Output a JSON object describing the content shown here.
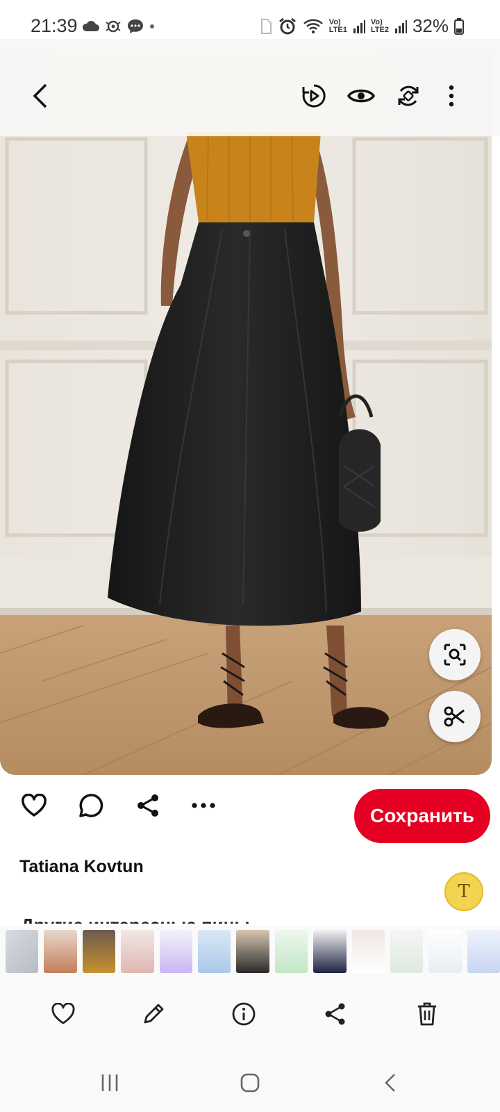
{
  "status_bar": {
    "time": "21:39",
    "battery": "32%",
    "sim1_label_top": "Vo)",
    "sim1_label_bottom": "LTE1",
    "sim2_label_top": "Vo)",
    "sim2_label_bottom": "LTE2",
    "left_icons": [
      "cloud-icon",
      "gear-bug-icon",
      "message-bubble-icon",
      "dot-icon"
    ],
    "right_icons": [
      "sim-icon",
      "alarm-icon",
      "wifi-icon",
      "signal-icon",
      "battery-icon"
    ]
  },
  "top_bar": {
    "icons": [
      "back-chevron-icon",
      "replay-icon",
      "eye-icon",
      "rotate-icon",
      "more-vertical-icon"
    ]
  },
  "pin": {
    "float_buttons": [
      "visual-search-icon",
      "scissors-icon"
    ]
  },
  "actions": {
    "icons": [
      "heart-icon",
      "comment-icon",
      "share-icon",
      "more-horizontal-icon"
    ],
    "save_label": "Сохранить"
  },
  "author": {
    "name": "Tatiana Kovtun",
    "avatar_letter": "T"
  },
  "more_heading": "Другие интересные пины",
  "gallery_bar": {
    "icons": [
      "heart-outline-icon",
      "edit-pencil-icon",
      "info-icon",
      "share-icon",
      "trash-icon"
    ]
  },
  "nav_bar": {
    "icons": [
      "recents-icon",
      "home-icon",
      "back-icon"
    ]
  },
  "colors": {
    "accent": "#e60023",
    "top_color": "#d18a1e",
    "skirt_color": "#1f1f1f"
  }
}
